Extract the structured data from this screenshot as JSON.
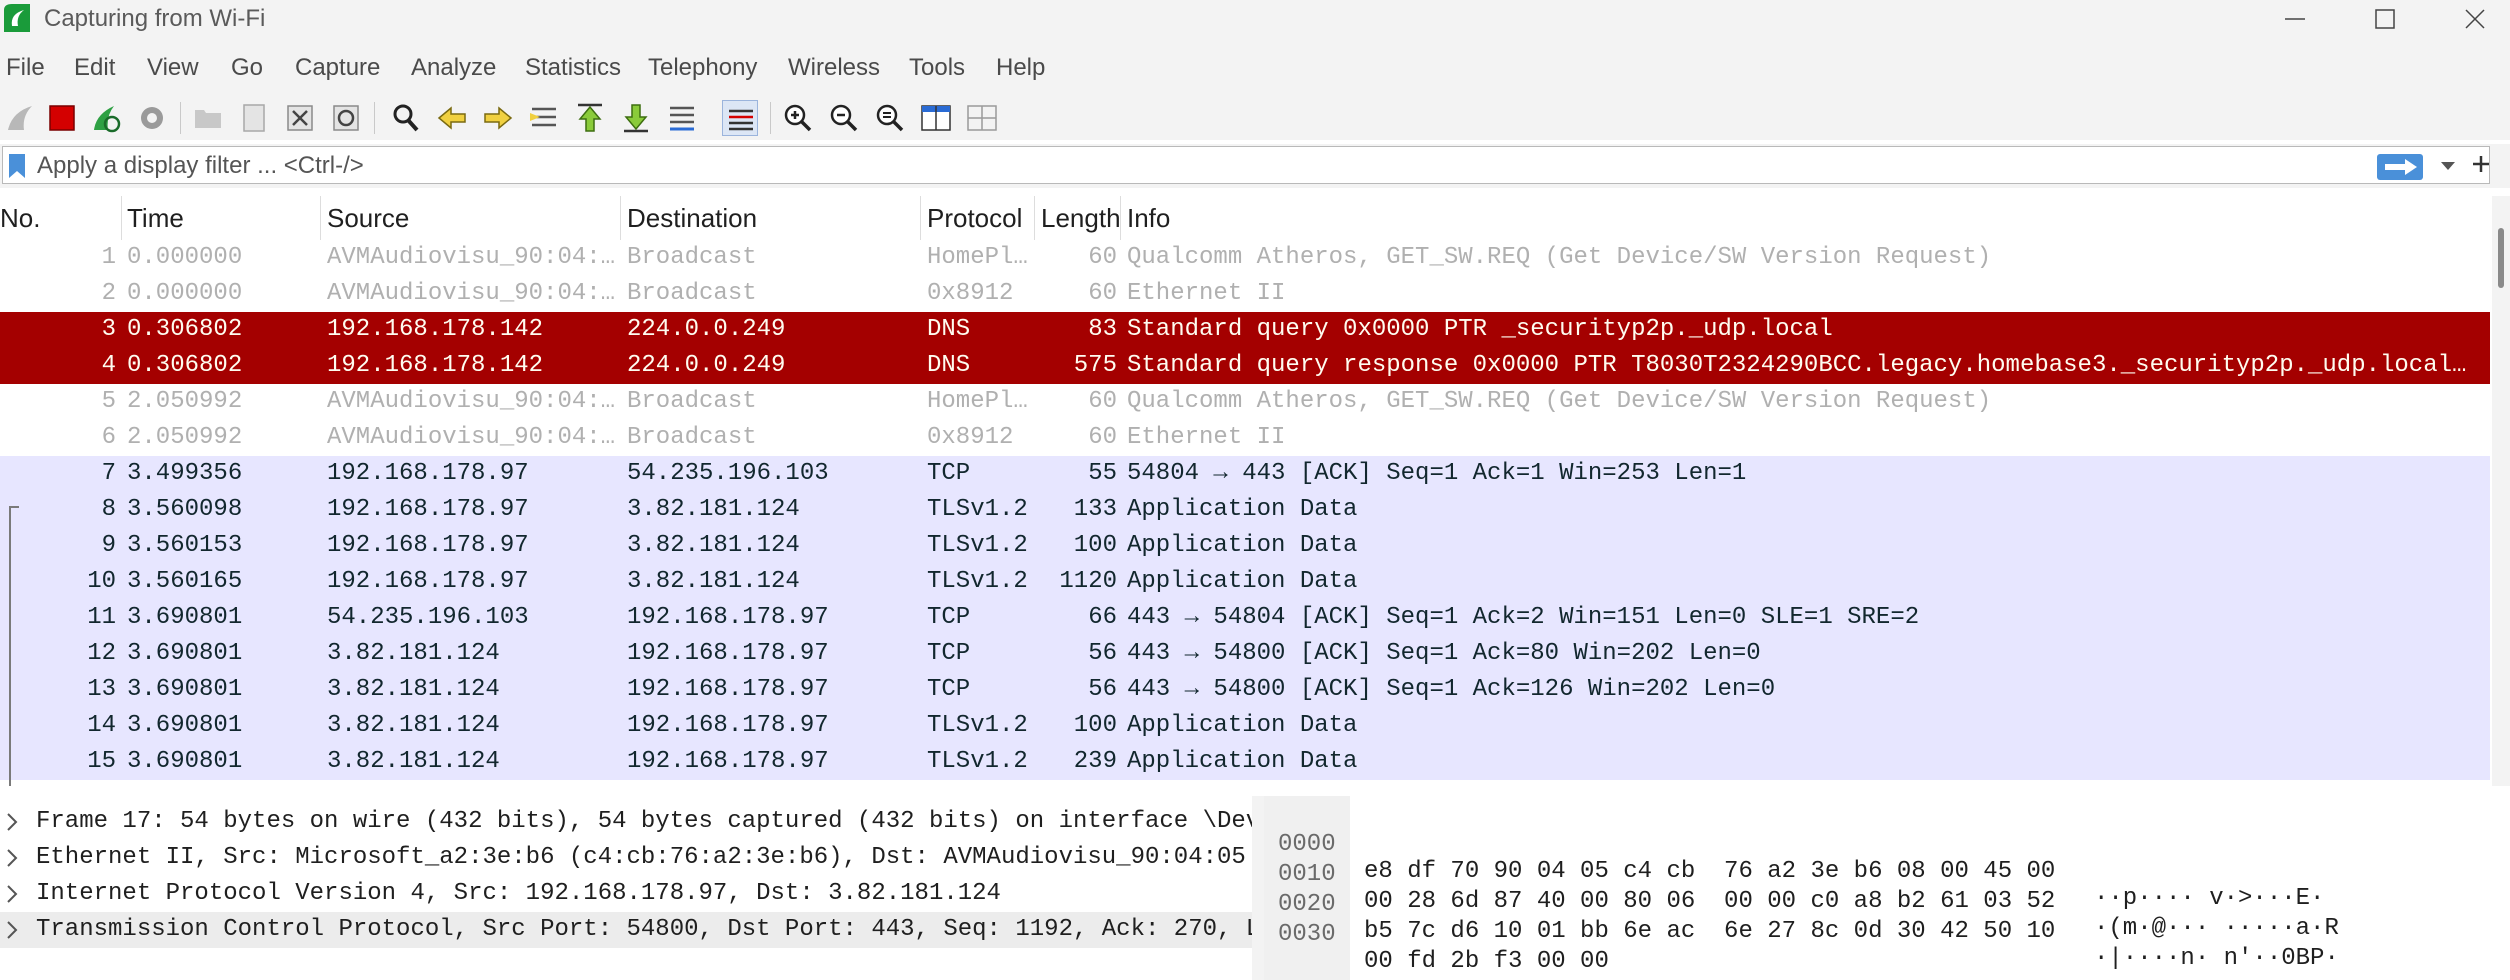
{
  "window": {
    "title": "Capturing from Wi-Fi"
  },
  "menu": [
    "File",
    "Edit",
    "View",
    "Go",
    "Capture",
    "Analyze",
    "Statistics",
    "Telephony",
    "Wireless",
    "Tools",
    "Help"
  ],
  "filter": {
    "placeholder": "Apply a display filter ... <Ctrl-/>"
  },
  "columns": [
    "No.",
    "Time",
    "Source",
    "Destination",
    "Protocol",
    "Length",
    "Info"
  ],
  "packets": [
    {
      "no": "1",
      "time": "0.000000",
      "source": "AVMAudiovisu_90:04:…",
      "destination": "Broadcast",
      "protocol": "HomePl…",
      "length": "60",
      "info": "Qualcomm Atheros, GET_SW.REQ (Get Device/SW Version Request)",
      "style": "grey"
    },
    {
      "no": "2",
      "time": "0.000000",
      "source": "AVMAudiovisu_90:04:…",
      "destination": "Broadcast",
      "protocol": "0x8912",
      "length": "60",
      "info": "Ethernet II",
      "style": "grey"
    },
    {
      "no": "3",
      "time": "0.306802",
      "source": "192.168.178.142",
      "destination": "224.0.0.249",
      "protocol": "DNS",
      "length": "83",
      "info": "Standard query 0x0000 PTR _securityp2p._udp.local",
      "style": "red"
    },
    {
      "no": "4",
      "time": "0.306802",
      "source": "192.168.178.142",
      "destination": "224.0.0.249",
      "protocol": "DNS",
      "length": "575",
      "info": "Standard query response 0x0000 PTR T8030T2324290BCC.legacy.homebase3._securityp2p._udp.local …",
      "style": "red"
    },
    {
      "no": "5",
      "time": "2.050992",
      "source": "AVMAudiovisu_90:04:…",
      "destination": "Broadcast",
      "protocol": "HomePl…",
      "length": "60",
      "info": "Qualcomm Atheros, GET_SW.REQ (Get Device/SW Version Request)",
      "style": "grey"
    },
    {
      "no": "6",
      "time": "2.050992",
      "source": "AVMAudiovisu_90:04:…",
      "destination": "Broadcast",
      "protocol": "0x8912",
      "length": "60",
      "info": "Ethernet II",
      "style": "grey"
    },
    {
      "no": "7",
      "time": "3.499356",
      "source": "192.168.178.97",
      "destination": "54.235.196.103",
      "protocol": "TCP",
      "length": "55",
      "info": "54804 → 443 [ACK] Seq=1 Ack=1 Win=253 Len=1",
      "style": "lav"
    },
    {
      "no": "8",
      "time": "3.560098",
      "source": "192.168.178.97",
      "destination": "3.82.181.124",
      "protocol": "TLSv1.2",
      "length": "133",
      "info": "Application Data",
      "style": "lav"
    },
    {
      "no": "9",
      "time": "3.560153",
      "source": "192.168.178.97",
      "destination": "3.82.181.124",
      "protocol": "TLSv1.2",
      "length": "100",
      "info": "Application Data",
      "style": "lav"
    },
    {
      "no": "10",
      "time": "3.560165",
      "source": "192.168.178.97",
      "destination": "3.82.181.124",
      "protocol": "TLSv1.2",
      "length": "1120",
      "info": "Application Data",
      "style": "lav"
    },
    {
      "no": "11",
      "time": "3.690801",
      "source": "54.235.196.103",
      "destination": "192.168.178.97",
      "protocol": "TCP",
      "length": "66",
      "info": "443 → 54804 [ACK] Seq=1 Ack=2 Win=151 Len=0 SLE=1 SRE=2",
      "style": "lav"
    },
    {
      "no": "12",
      "time": "3.690801",
      "source": "3.82.181.124",
      "destination": "192.168.178.97",
      "protocol": "TCP",
      "length": "56",
      "info": "443 → 54800 [ACK] Seq=1 Ack=80 Win=202 Len=0",
      "style": "lav"
    },
    {
      "no": "13",
      "time": "3.690801",
      "source": "3.82.181.124",
      "destination": "192.168.178.97",
      "protocol": "TCP",
      "length": "56",
      "info": "443 → 54800 [ACK] Seq=1 Ack=126 Win=202 Len=0",
      "style": "lav"
    },
    {
      "no": "14",
      "time": "3.690801",
      "source": "3.82.181.124",
      "destination": "192.168.178.97",
      "protocol": "TLSv1.2",
      "length": "100",
      "info": "Application Data",
      "style": "lav"
    },
    {
      "no": "15",
      "time": "3.690801",
      "source": "3.82.181.124",
      "destination": "192.168.178.97",
      "protocol": "TLSv1.2",
      "length": "239",
      "info": "Application Data",
      "style": "lav"
    }
  ],
  "details": [
    "Frame 17: 54 bytes on wire (432 bits), 54 bytes captured (432 bits) on interface \\Dev",
    "Ethernet II, Src: Microsoft_a2:3e:b6 (c4:cb:76:a2:3e:b6), Dst: AVMAudiovisu_90:04:05",
    "Internet Protocol Version 4, Src: 192.168.178.97, Dst: 3.82.181.124",
    "Transmission Control Protocol, Src Port: 54800, Dst Port: 443, Seq: 1192, Ack: 270, L"
  ],
  "bytes": [
    {
      "offset": "0000",
      "hex": "e8 df 70 90 04 05 c4 cb  76 a2 3e b6 08 00 45 00",
      "ascii": "··p···· v·>···E·"
    },
    {
      "offset": "0010",
      "hex": "00 28 6d 87 40 00 80 06  00 00 c0 a8 b2 61 03 52",
      "ascii": "·(m·@··· ·····a·R"
    },
    {
      "offset": "0020",
      "hex": "b5 7c d6 10 01 bb 6e ac  6e 27 8c 0d 30 42 50 10",
      "ascii": "·|····n· n'··0BP·"
    },
    {
      "offset": "0030",
      "hex": "00 fd 2b f3 00 00",
      "ascii": "··+···"
    }
  ],
  "colors": {
    "dns_row_bg": "#a40000",
    "tcp_row_bg": "#e7e6ff",
    "capture_stop_red": "#d40000",
    "restart_green": "#2ea043"
  }
}
